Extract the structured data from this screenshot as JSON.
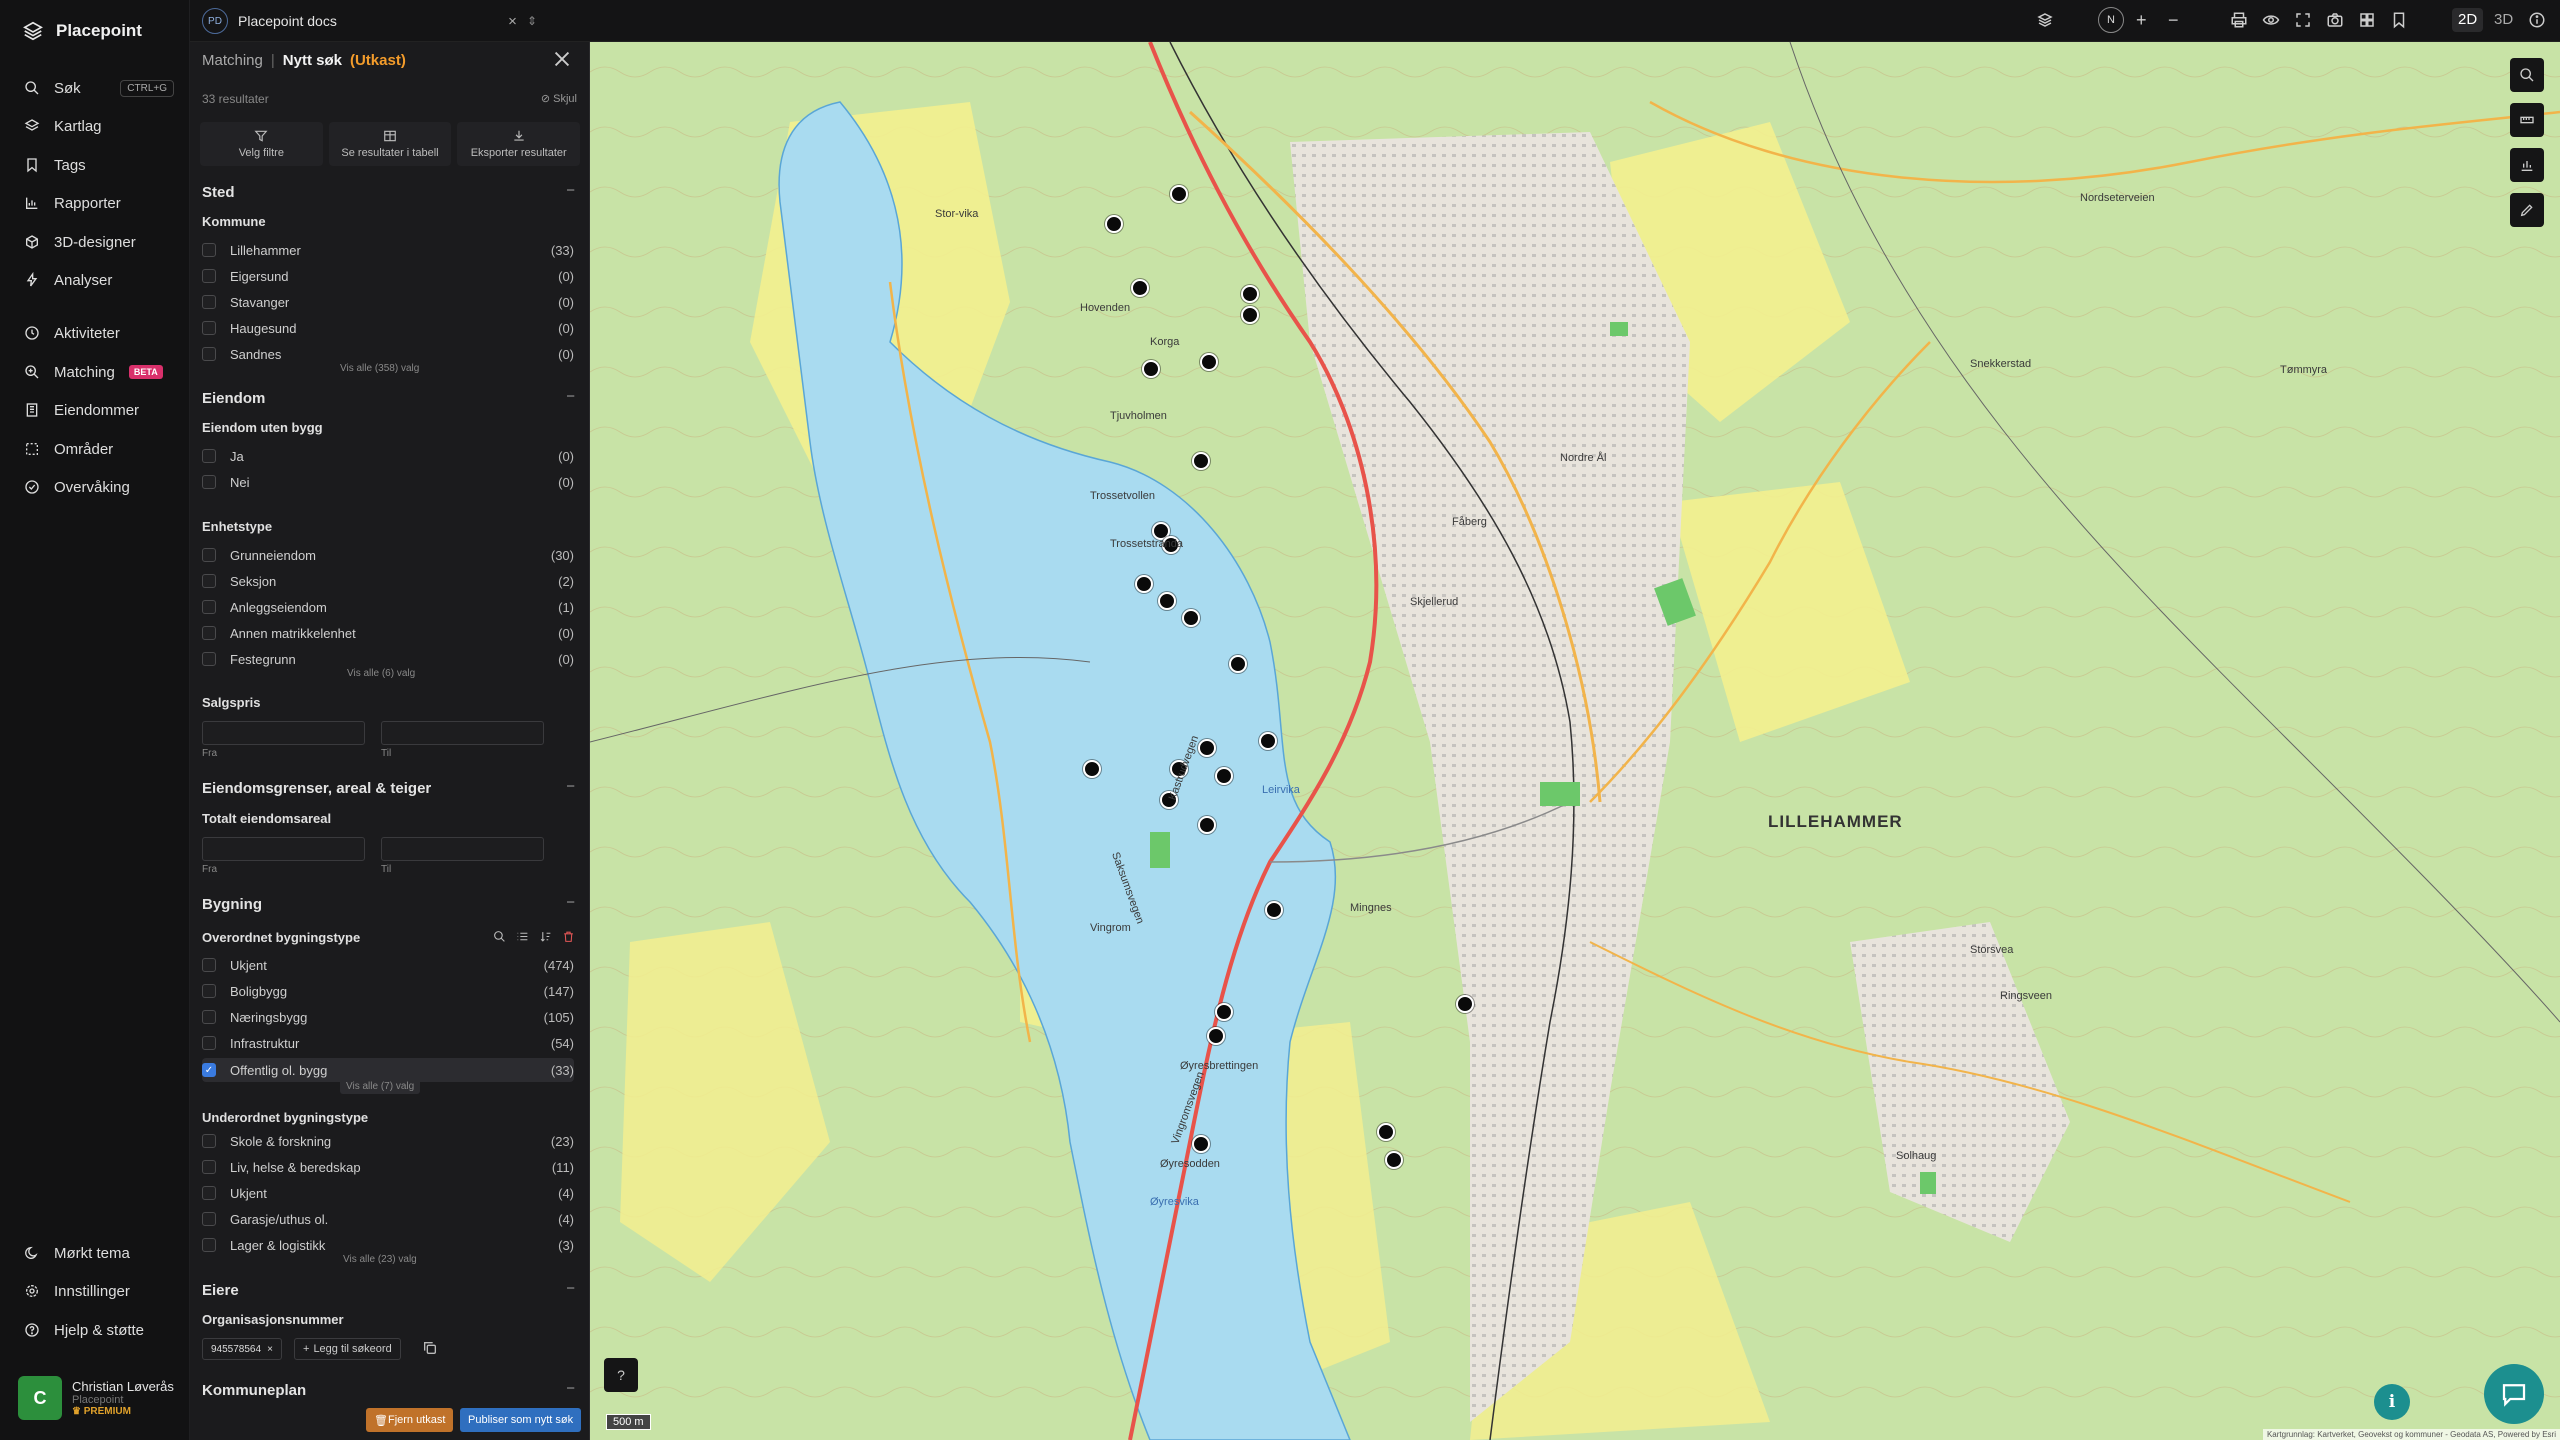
{
  "nav": {
    "brand": "Placepoint",
    "items": [
      {
        "label": "Søk",
        "icon": "search-icon",
        "shortcut": "CTRL+G"
      },
      {
        "label": "Kartlag",
        "icon": "layers-icon"
      },
      {
        "label": "Tags",
        "icon": "bookmark-icon"
      },
      {
        "label": "Rapporter",
        "icon": "chart-icon"
      },
      {
        "label": "3D-designer",
        "icon": "cube-icon"
      },
      {
        "label": "Analyser",
        "icon": "bolt-icon"
      },
      {
        "label": "Aktiviteter",
        "icon": "activity-icon"
      },
      {
        "label": "Matching",
        "icon": "match-icon",
        "badge": "BETA"
      },
      {
        "label": "Eiendommer",
        "icon": "building-icon"
      },
      {
        "label": "Områder",
        "icon": "area-icon"
      },
      {
        "label": "Overvåking",
        "icon": "monitor-icon"
      }
    ],
    "bottom": [
      {
        "label": "Mørkt tema",
        "icon": "moon-icon"
      },
      {
        "label": "Innstillinger",
        "icon": "gear-icon"
      },
      {
        "label": "Hjelp & støtte",
        "icon": "help-icon"
      }
    ],
    "user": {
      "initial": "C",
      "name": "Christian Løverås",
      "org": "Placepoint",
      "tier": "PREMIUM"
    }
  },
  "topbar": {
    "doc_initials": "PD",
    "doc_name": "Placepoint docs",
    "compass": "N",
    "mode_2d": "2D",
    "mode_3d": "3D"
  },
  "panel": {
    "crumb_section": "Matching",
    "crumb_title": "Nytt søk",
    "crumb_state": "(Utkast)",
    "result_count": "33 resultater",
    "hide_label": "Skjul",
    "actions": [
      "Velg filtre",
      "Se resultater i tabell",
      "Eksporter resultater"
    ],
    "sted": {
      "title": "Sted",
      "kommune_title": "Kommune",
      "kommune": [
        {
          "label": "Lillehammer",
          "count": "(33)"
        },
        {
          "label": "Eigersund",
          "count": "(0)"
        },
        {
          "label": "Stavanger",
          "count": "(0)"
        },
        {
          "label": "Haugesund",
          "count": "(0)"
        },
        {
          "label": "Sandnes",
          "count": "(0)"
        }
      ],
      "kommune_more": "Vis alle (358) valg"
    },
    "eiendom": {
      "title": "Eiendom",
      "uten_bygg_title": "Eiendom uten bygg",
      "uten_bygg": [
        {
          "label": "Ja",
          "count": "(0)"
        },
        {
          "label": "Nei",
          "count": "(0)"
        }
      ],
      "enhetstype_title": "Enhetstype",
      "enhetstype": [
        {
          "label": "Grunneiendom",
          "count": "(30)"
        },
        {
          "label": "Seksjon",
          "count": "(2)"
        },
        {
          "label": "Anleggseiendom",
          "count": "(1)"
        },
        {
          "label": "Annen matrikkelenhet",
          "count": "(0)"
        },
        {
          "label": "Festegrunn",
          "count": "(0)"
        }
      ],
      "enhetstype_more": "Vis alle (6) valg",
      "salgspris_title": "Salgspris",
      "from": "Fra",
      "to": "Til"
    },
    "grenser": {
      "title": "Eiendomsgrenser, areal & teiger",
      "areal_title": "Totalt eiendomsareal",
      "from": "Fra",
      "to": "Til"
    },
    "bygning": {
      "title": "Bygning",
      "over_title": "Overordnet bygningstype",
      "over": [
        {
          "label": "Ukjent",
          "count": "(474)"
        },
        {
          "label": "Boligbygg",
          "count": "(147)"
        },
        {
          "label": "Næringsbygg",
          "count": "(105)"
        },
        {
          "label": "Infrastruktur",
          "count": "(54)"
        },
        {
          "label": "Offentlig ol. bygg",
          "count": "(33)",
          "selected": true
        }
      ],
      "over_more": "Vis alle (7) valg",
      "under_title": "Underordnet bygningstype",
      "under": [
        {
          "label": "Skole & forskning",
          "count": "(23)"
        },
        {
          "label": "Liv, helse & beredskap",
          "count": "(11)"
        },
        {
          "label": "Ukjent",
          "count": "(4)"
        },
        {
          "label": "Garasje/uthus ol.",
          "count": "(4)"
        },
        {
          "label": "Lager & logistikk",
          "count": "(3)"
        }
      ],
      "under_more": "Vis alle (23) valg"
    },
    "eiere": {
      "title": "Eiere",
      "org_title": "Organisasjonsnummer",
      "tag": "945578564",
      "add_label": "Legg til søkeord"
    },
    "kommuneplan": {
      "title": "Kommuneplan"
    },
    "remove_label": "Fjern utkast",
    "publish_label": "Publiser som nytt søk"
  },
  "map": {
    "town": "LILLEHAMMER",
    "scale": "500 m",
    "attribution": "Kartgrunnlag: Kartverket, Geovekst og kommuner - Geodata AS, Powered by Esri",
    "labels": [
      "Nordseterveien",
      "Kastrudvegen",
      "Saksumsvegen",
      "Vingrom",
      "Mingnes",
      "Øyresbrettingen",
      "Øyresodden",
      "Leirvika",
      "Tjuvholmen",
      "Trossetvollen",
      "Trossetstranda",
      "Korga",
      "Stor-vika",
      "Hovenden",
      "Skjellerud",
      "Fåberg",
      "Nordre Ål",
      "Ringsveen",
      "Solhaug",
      "Tømmyra",
      "Snekkerstad",
      "Storsvea",
      "Øyresvika",
      "Vingromsvegen"
    ]
  },
  "markers": [
    [
      0.299,
      0.109
    ],
    [
      0.266,
      0.13
    ],
    [
      0.279,
      0.176
    ],
    [
      0.285,
      0.234
    ],
    [
      0.335,
      0.18
    ],
    [
      0.335,
      0.195
    ],
    [
      0.314,
      0.229
    ],
    [
      0.31,
      0.3
    ],
    [
      0.29,
      0.35
    ],
    [
      0.295,
      0.36
    ],
    [
      0.281,
      0.388
    ],
    [
      0.293,
      0.4
    ],
    [
      0.305,
      0.412
    ],
    [
      0.329,
      0.445
    ],
    [
      0.255,
      0.52
    ],
    [
      0.313,
      0.505
    ],
    [
      0.299,
      0.52
    ],
    [
      0.322,
      0.525
    ],
    [
      0.294,
      0.542
    ],
    [
      0.313,
      0.56
    ],
    [
      0.344,
      0.5
    ],
    [
      0.347,
      0.621
    ],
    [
      0.322,
      0.694
    ],
    [
      0.318,
      0.711
    ],
    [
      0.444,
      0.688
    ],
    [
      0.31,
      0.788
    ],
    [
      0.404,
      0.78
    ],
    [
      0.408,
      0.8
    ]
  ]
}
